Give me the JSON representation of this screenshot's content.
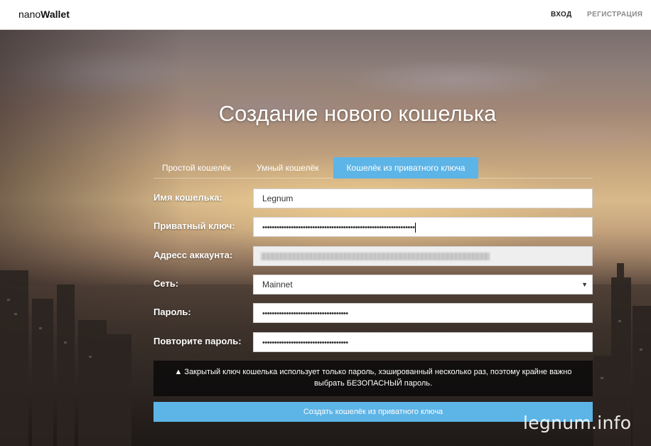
{
  "navbar": {
    "brand_prefix": "nano",
    "brand_bold": "Wallet",
    "login": "ВХОД",
    "register": "РЕГИСТРАЦИЯ"
  },
  "page": {
    "title": "Создание нового кошелька"
  },
  "tabs": [
    {
      "label": "Простой кошелёк",
      "active": false
    },
    {
      "label": "Умный кошелёк",
      "active": false
    },
    {
      "label": "Кошелёк из приватного ключа",
      "active": true
    }
  ],
  "form": {
    "wallet_name": {
      "label": "Имя кошелька:",
      "value": "Legnum"
    },
    "private_key": {
      "label": "Приватный ключ:",
      "value": "••••••••••••••••••••••••••••••••••••••••••••••••••••••••••••••••"
    },
    "account_address": {
      "label": "Адресс аккаунта:"
    },
    "network": {
      "label": "Сеть:",
      "value": "Mainnet"
    },
    "password": {
      "label": "Пароль:",
      "value": "••••••••••••••••••••••••••••••••••••"
    },
    "repeat_password": {
      "label": "Повторите пароль:",
      "value": "••••••••••••••••••••••••••••••••••••"
    }
  },
  "warning": {
    "icon": "warning-triangle-icon",
    "text": "Закрытый ключ кошелька использует только пароль, хэшированный несколько раз, поэтому крайне важно выбрать БЕЗОПАСНЫЙ пароль."
  },
  "submit_label": "Создать кошелёк из приватного ключа",
  "watermark": "legnum.info",
  "colors": {
    "accent": "#5db4e6",
    "navbar_bg": "#ffffff",
    "warning_bg": "#111111"
  }
}
